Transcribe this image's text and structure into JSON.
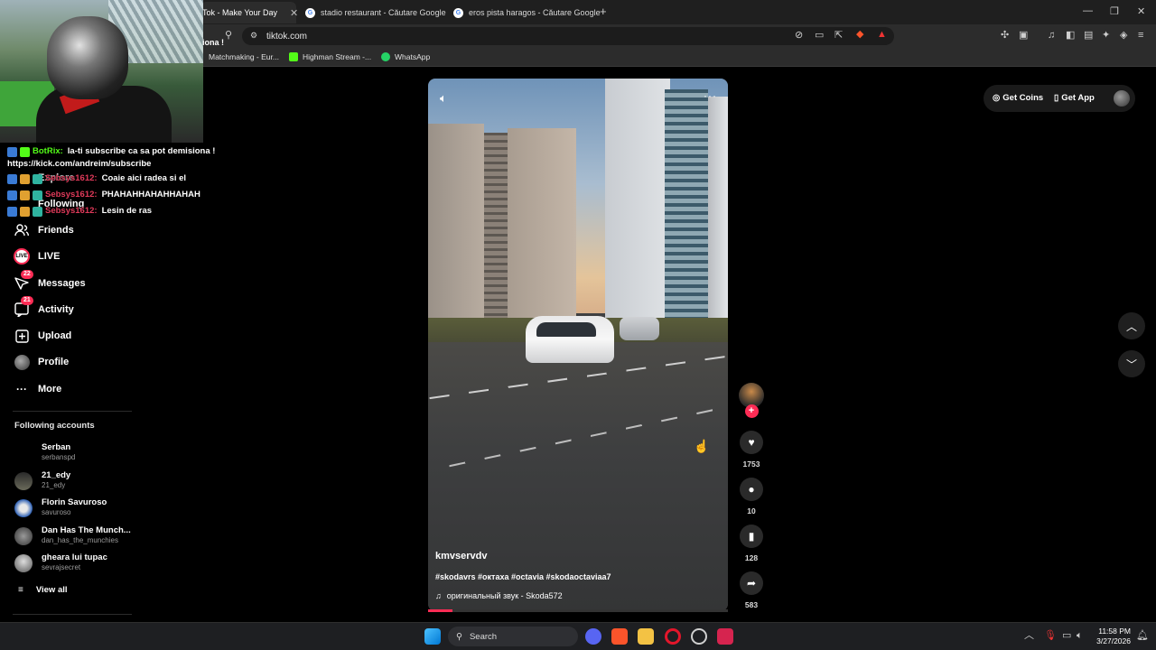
{
  "browser": {
    "tabs": [
      {
        "label": "Tok - Make Your Day",
        "active": true
      },
      {
        "label": "stadio restaurant - Căutare Google",
        "active": false
      },
      {
        "label": "eros pista haragos - Căutare Google",
        "active": false
      }
    ],
    "new_tab": "+",
    "url": "tiktok.com",
    "bookmarks": [
      "Matchmaking - Eur...",
      "Highman Stream -...",
      "WhatsApp"
    ],
    "window_controls": {
      "minimize": "—",
      "restore": "❐",
      "close": "✕"
    }
  },
  "stream_overlay": {
    "cut_text": "iona !",
    "chat": [
      {
        "user": "BotRix:",
        "text": "la-ti subscribe ca sa pot demisiona !"
      },
      {
        "user": "",
        "text": "https://kick.com/andreim/subscribe"
      },
      {
        "user": "Sebsys1612:",
        "text": "Coaie aici radea si el"
      },
      {
        "user": "Sebsys1612:",
        "text": "PHAHAHHAHAHHAHAH"
      },
      {
        "user": "Sebsys1612:",
        "text": "Lesin de ras"
      }
    ]
  },
  "sidebar": {
    "ghost_items": [
      "Explore",
      "Following"
    ],
    "items": [
      {
        "label": "Friends",
        "icon": "friends-icon"
      },
      {
        "label": "LIVE",
        "icon": "live-icon"
      },
      {
        "label": "Messages",
        "icon": "messages-icon",
        "count": "22"
      },
      {
        "label": "Activity",
        "icon": "activity-icon",
        "count": "21"
      },
      {
        "label": "Upload",
        "icon": "upload-icon"
      },
      {
        "label": "Profile",
        "icon": "profile-icon"
      },
      {
        "label": "More",
        "icon": "more-icon"
      }
    ],
    "following_title": "Following accounts",
    "accounts": [
      {
        "name": "Serban",
        "handle": "serbanspd"
      },
      {
        "name": "21_edy",
        "handle": "21_edy"
      },
      {
        "name": "Florin Savuroso",
        "handle": "savuroso"
      },
      {
        "name": "Dan Has The Munch...",
        "handle": "dan_has_the_munchies"
      },
      {
        "name": "gheara lui tupac",
        "handle": "sevrajsecret"
      }
    ],
    "view_all": "View all"
  },
  "video": {
    "author": "kmvservdv",
    "caption": "#skodavrs #октаха #octavia #skodaoctaviaa7",
    "sound": "оригинальный звук - Skoda572",
    "progress": 0.08
  },
  "actions": {
    "likes": "1753",
    "comments": "10",
    "saves": "128",
    "shares": "583"
  },
  "header_actions": {
    "get_coins": "Get Coins",
    "get_app": "Get App"
  },
  "taskbar": {
    "search": "Search",
    "time": "11:58 PM",
    "date": "3/27/2026"
  }
}
